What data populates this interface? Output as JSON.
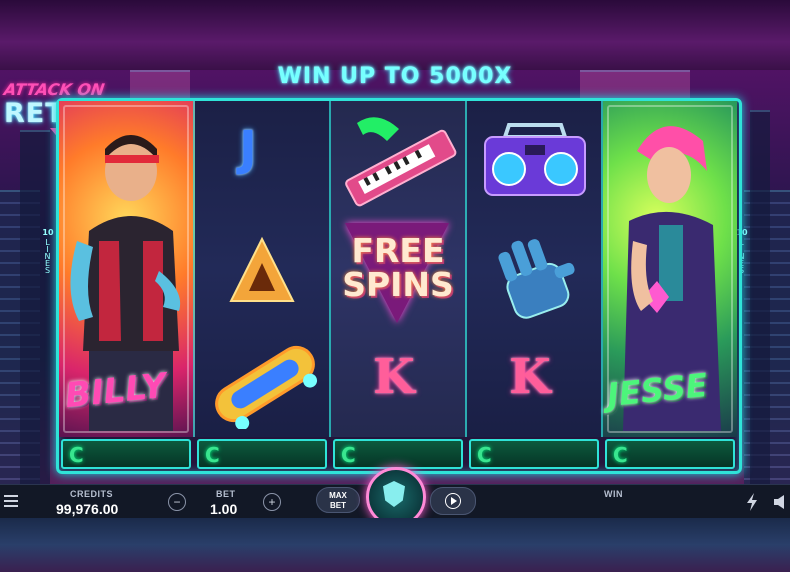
{
  "banner": {
    "text": "WIN UP TO 5000X"
  },
  "logo": {
    "line1": "ATTACK ON",
    "line2": "RETRO"
  },
  "reels": {
    "side_lines_label": "LINES",
    "side_lines_count": "10",
    "symbols": {
      "r1": {
        "name": "BILLY"
      },
      "r2": {
        "top": "J",
        "mid": "^"
      },
      "r3": {
        "free1": "FREE",
        "free2": "SPINS",
        "bottom": "K"
      },
      "r4": {
        "bottom": "K"
      },
      "r5": {
        "name": "JESSE"
      }
    },
    "plate_letter": "C"
  },
  "hud": {
    "menu_icon": "hamburger-icon",
    "credits_label": "CREDITS",
    "credits_value": "99,976.00",
    "bet_label": "BET",
    "bet_value": "1.00",
    "minus": "−",
    "plus": "+",
    "maxbet_line1": "MAX",
    "maxbet_line2": "BET",
    "win_label": "WIN",
    "turbo_icon": "lightning-icon",
    "sound_icon": "speaker-icon"
  },
  "colors": {
    "accent": "#2fe3d8",
    "spin_ring": "#ff8ad8",
    "billy": "#ff4ab4",
    "jesse": "#4cf57b"
  }
}
